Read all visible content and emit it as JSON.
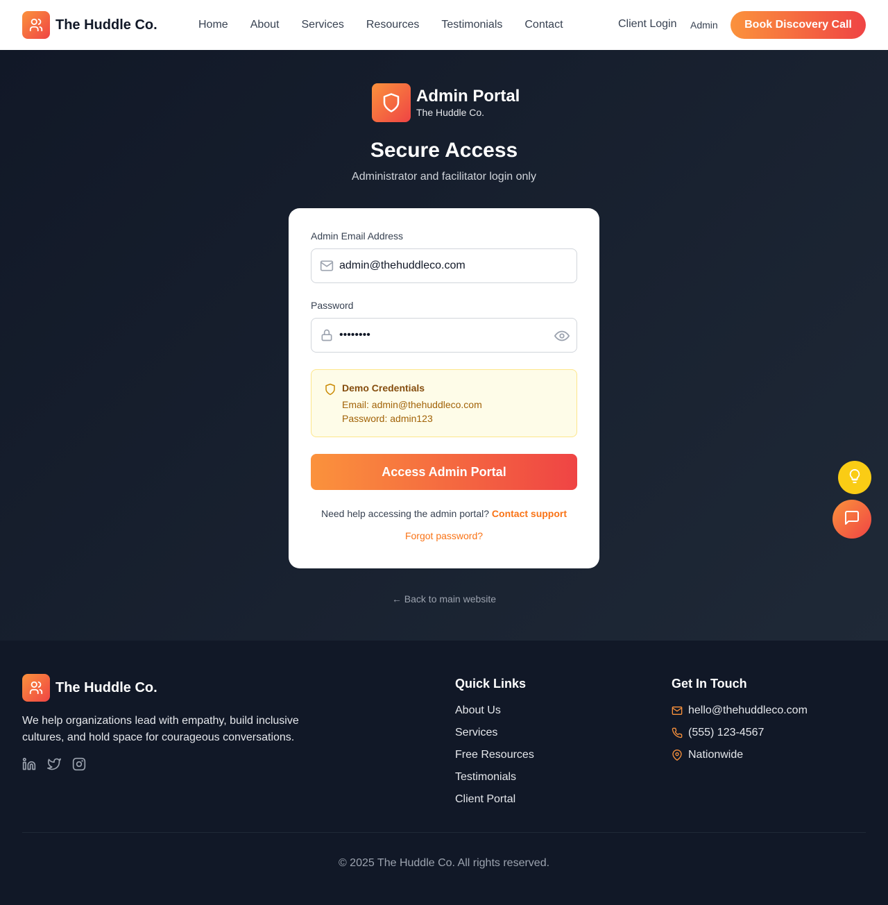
{
  "header": {
    "brand": "The Huddle Co.",
    "nav": [
      "Home",
      "About",
      "Services",
      "Resources",
      "Testimonials",
      "Contact"
    ],
    "client_login": "Client Login",
    "admin": "Admin",
    "cta": "Book Discovery Call"
  },
  "portal": {
    "title": "Admin Portal",
    "subtitle": "The Huddle Co.",
    "heading": "Secure Access",
    "tagline": "Administrator and facilitator login only"
  },
  "form": {
    "email_label": "Admin Email Address",
    "email_value": "admin@thehuddleco.com",
    "password_label": "Password",
    "password_value": "admin123",
    "demo_title": "Demo Credentials",
    "demo_email": "Email: admin@thehuddleco.com",
    "demo_password": "Password: admin123",
    "submit": "Access Admin Portal",
    "help_text": "Need help accessing the admin portal? ",
    "help_link": "Contact support",
    "forgot": "Forgot password?"
  },
  "back_link": "← Back to main website",
  "footer": {
    "brand": "The Huddle Co.",
    "description": "We help organizations lead with empathy, build inclusive cultures, and hold space for courageous conversations.",
    "socials": [
      "linkedin-icon",
      "twitter-icon",
      "instagram-icon"
    ],
    "quick_links_title": "Quick Links",
    "quick_links": [
      "About Us",
      "Services",
      "Free Resources",
      "Testimonials",
      "Client Portal"
    ],
    "contact_title": "Get In Touch",
    "email": "hello@thehuddleco.com",
    "phone": "(555) 123-4567",
    "location": "Nationwide",
    "copyright": "© 2025 The Huddle Co. All rights reserved."
  },
  "colors": {
    "accent_start": "#fb923c",
    "accent_end": "#ef4444",
    "dark_bg": "#111827",
    "demo_bg": "#fefce8",
    "bulb": "#facc15"
  }
}
